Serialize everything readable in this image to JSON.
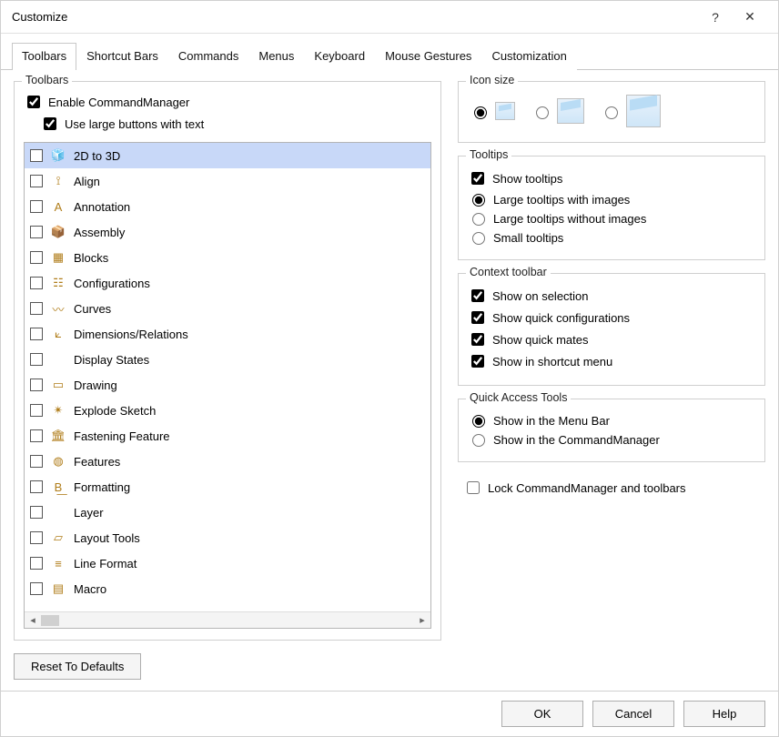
{
  "window": {
    "title": "Customize"
  },
  "tabs": [
    "Toolbars",
    "Shortcut Bars",
    "Commands",
    "Menus",
    "Keyboard",
    "Mouse Gestures",
    "Customization"
  ],
  "activeTab": 0,
  "toolbarsGroup": {
    "legend": "Toolbars",
    "enableCM": "Enable CommandManager",
    "useLarge": "Use large buttons with text"
  },
  "toolbarItems": [
    {
      "label": "2D to 3D",
      "selected": true,
      "icon": "🧊"
    },
    {
      "label": "Align",
      "icon": "⟟"
    },
    {
      "label": "Annotation",
      "icon": "A"
    },
    {
      "label": "Assembly",
      "icon": "📦"
    },
    {
      "label": "Blocks",
      "icon": "▦"
    },
    {
      "label": "Configurations",
      "icon": "☷"
    },
    {
      "label": "Curves",
      "icon": "〰"
    },
    {
      "label": "Dimensions/Relations",
      "icon": "⟀"
    },
    {
      "label": "Display States",
      "icon": ""
    },
    {
      "label": "Drawing",
      "icon": "▭"
    },
    {
      "label": "Explode Sketch",
      "icon": "✴"
    },
    {
      "label": "Fastening Feature",
      "icon": "🏛"
    },
    {
      "label": "Features",
      "icon": "◍"
    },
    {
      "label": "Formatting",
      "icon": "B͟"
    },
    {
      "label": "Layer",
      "icon": ""
    },
    {
      "label": "Layout Tools",
      "icon": "▱"
    },
    {
      "label": "Line Format",
      "icon": "≡"
    },
    {
      "label": "Macro",
      "icon": "▤"
    }
  ],
  "resetBtn": "Reset To Defaults",
  "iconSize": {
    "legend": "Icon size"
  },
  "tooltips": {
    "legend": "Tooltips",
    "show": "Show tooltips",
    "largeImg": "Large tooltips with images",
    "largeNoImg": "Large tooltips without images",
    "small": "Small tooltips"
  },
  "contextToolbar": {
    "legend": "Context toolbar",
    "showSel": "Show on selection",
    "quickConf": "Show quick configurations",
    "quickMates": "Show quick mates",
    "shortcut": "Show in shortcut menu"
  },
  "quickAccess": {
    "legend": "Quick Access Tools",
    "menuBar": "Show in the Menu Bar",
    "cmdMgr": "Show in the CommandManager"
  },
  "lock": "Lock CommandManager and toolbars",
  "footer": {
    "ok": "OK",
    "cancel": "Cancel",
    "help": "Help"
  }
}
